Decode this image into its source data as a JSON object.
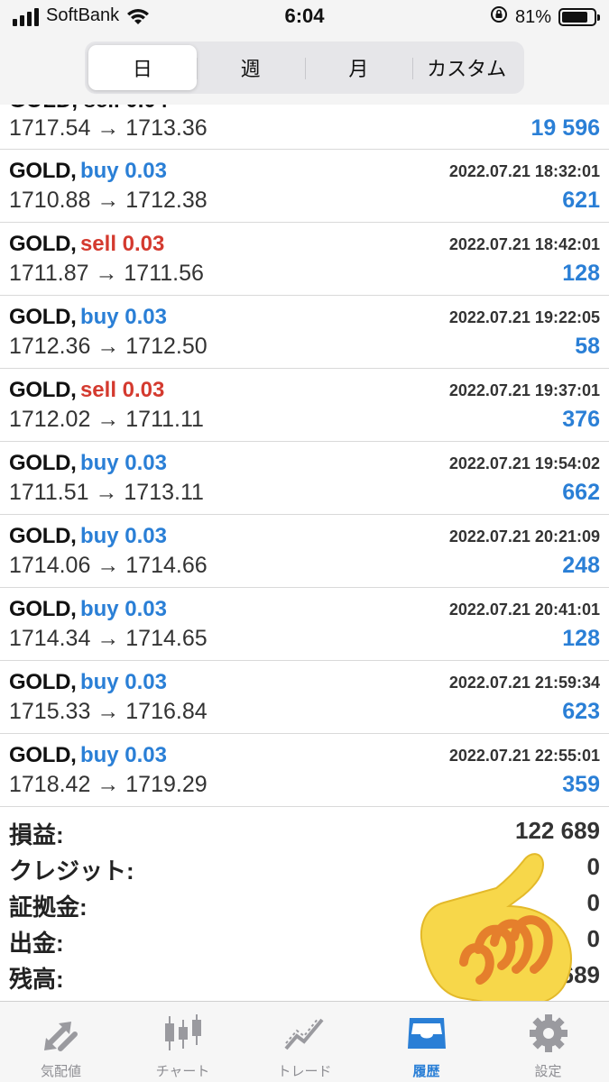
{
  "status_bar": {
    "carrier": "SoftBank",
    "time": "6:04",
    "battery": "81%",
    "battery_level": 0.81
  },
  "period_tabs": [
    {
      "label": "日",
      "active": true
    },
    {
      "label": "週",
      "active": false
    },
    {
      "label": "月",
      "active": false
    },
    {
      "label": "カスタム",
      "active": false
    }
  ],
  "partial_trade": {
    "prices": "1717.54 → 1713.36",
    "profit": "19 596"
  },
  "trades": [
    {
      "symbol": "GOLD,",
      "side": "buy 0.03",
      "type": "buy",
      "datetime": "2022.07.21 18:32:01",
      "prices": "1710.88 → 1712.38",
      "profit": "621"
    },
    {
      "symbol": "GOLD,",
      "side": "sell 0.03",
      "type": "sell",
      "datetime": "2022.07.21 18:42:01",
      "prices": "1711.87 → 1711.56",
      "profit": "128"
    },
    {
      "symbol": "GOLD,",
      "side": "buy 0.03",
      "type": "buy",
      "datetime": "2022.07.21 19:22:05",
      "prices": "1712.36 → 1712.50",
      "profit": "58"
    },
    {
      "symbol": "GOLD,",
      "side": "sell 0.03",
      "type": "sell",
      "datetime": "2022.07.21 19:37:01",
      "prices": "1712.02 → 1711.11",
      "profit": "376"
    },
    {
      "symbol": "GOLD,",
      "side": "buy 0.03",
      "type": "buy",
      "datetime": "2022.07.21 19:54:02",
      "prices": "1711.51 → 1713.11",
      "profit": "662"
    },
    {
      "symbol": "GOLD,",
      "side": "buy 0.03",
      "type": "buy",
      "datetime": "2022.07.21 20:21:09",
      "prices": "1714.06 → 1714.66",
      "profit": "248"
    },
    {
      "symbol": "GOLD,",
      "side": "buy 0.03",
      "type": "buy",
      "datetime": "2022.07.21 20:41:01",
      "prices": "1714.34 → 1714.65",
      "profit": "128"
    },
    {
      "symbol": "GOLD,",
      "side": "buy 0.03",
      "type": "buy",
      "datetime": "2022.07.21 21:59:34",
      "prices": "1715.33 → 1716.84",
      "profit": "623"
    },
    {
      "symbol": "GOLD,",
      "side": "buy 0.03",
      "type": "buy",
      "datetime": "2022.07.21 22:55:01",
      "prices": "1718.42 → 1719.29",
      "profit": "359"
    }
  ],
  "summary": [
    {
      "label": "損益:",
      "value": "122 689"
    },
    {
      "label": "クレジット:",
      "value": "0"
    },
    {
      "label": "証拠金:",
      "value": "0"
    },
    {
      "label": "出金:",
      "value": "0"
    },
    {
      "label": "残高:",
      "value": "689"
    }
  ],
  "tabbar": [
    {
      "label": "気配値",
      "icon": "arrows-icon",
      "active": false
    },
    {
      "label": "チャート",
      "icon": "candlestick-icon",
      "active": false
    },
    {
      "label": "トレード",
      "icon": "trend-line-icon",
      "active": false
    },
    {
      "label": "履歴",
      "icon": "inbox-icon",
      "active": true
    },
    {
      "label": "設定",
      "icon": "gear-icon",
      "active": false
    }
  ],
  "colors": {
    "buy": "#2a7fd6",
    "sell": "#d43a2f",
    "profit": "#2a7fd6",
    "tab_active": "#2a7fd6"
  }
}
